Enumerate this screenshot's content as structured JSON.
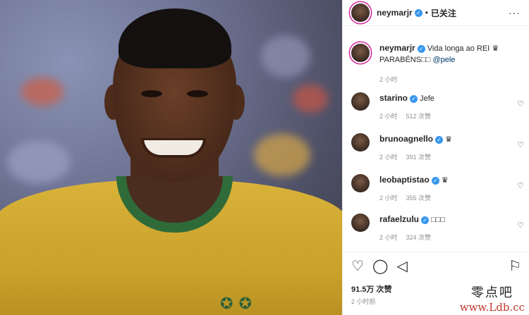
{
  "post": {
    "username": "neymarjr",
    "follow_label": "已关注",
    "more_label": "···"
  },
  "caption": {
    "username": "neymarjr",
    "line1": "Vida longa ao REI",
    "crown": "♛",
    "line2": "PARABÉNS□□",
    "mention": "@pele",
    "time": "2 小时"
  },
  "comments": [
    {
      "username": "starino",
      "text": "Jefe",
      "time": "2 小时",
      "likes": "512 次赞"
    },
    {
      "username": "brunoagnello",
      "text": "♛",
      "time": "2 小时",
      "likes": "391 次赞"
    },
    {
      "username": "leobaptistao",
      "text": "♛",
      "time": "2 小时",
      "likes": "355 次赞"
    },
    {
      "username": "rafaelzulu",
      "text": "□□□",
      "time": "2 小时",
      "likes": "324 次赞"
    }
  ],
  "actions": {
    "like_icon": "heart-icon",
    "comment_icon": "comment-icon",
    "share_icon": "share-icon",
    "save_icon": "bookmark-icon"
  },
  "likes_total": "91.5万 次赞",
  "post_time": "2 小时前",
  "watermark": {
    "top": "零点吧",
    "bottom": "www.Ldb.cc"
  },
  "colors": {
    "verified": "#3897f0",
    "link": "#00376b",
    "muted": "#8e8e8e",
    "shirt": "#d9b23a",
    "collar": "#2f6b39"
  }
}
